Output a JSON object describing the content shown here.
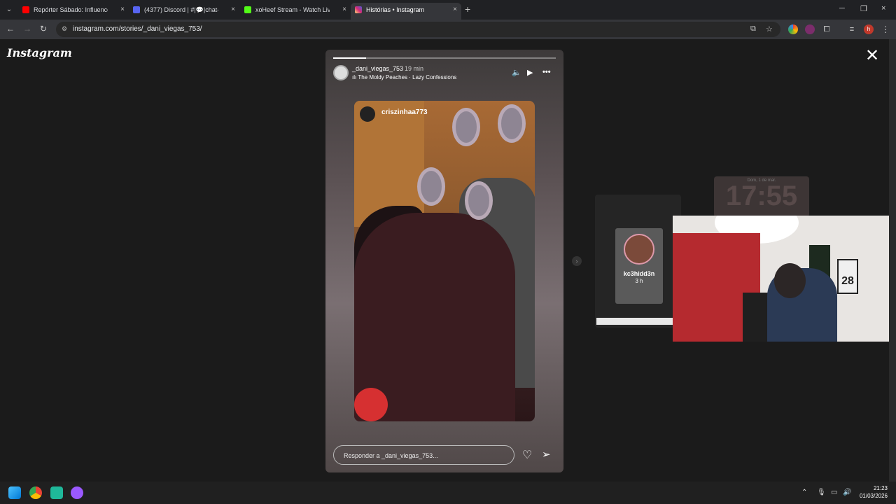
{
  "browser": {
    "tabs": [
      {
        "title": "Repórter Sábado: Influencers p",
        "favicon_color": "#ff0000",
        "active": false
      },
      {
        "title": "(4377) Discord | #|💬|chat-gen",
        "favicon_color": "#5865f2",
        "active": false
      },
      {
        "title": "xoHeef Stream - Watch Live on",
        "favicon_color": "#53fc18",
        "active": false
      },
      {
        "title": "Histórias • Instagram",
        "favicon_color": "#e1306c",
        "active": true
      }
    ],
    "url": "instagram.com/stories/_dani_viegas_753/",
    "new_tab_label": "+",
    "close_glyph": "×",
    "min_glyph": "─",
    "max_glyph": "❐"
  },
  "instagram": {
    "logo": "Instagram",
    "close": "✕",
    "story": {
      "username": "_dani_viegas_753",
      "time": "19 min",
      "music": "The Moldy Peaches · Lazy Confessions",
      "progress": [
        1.0,
        0.0,
        0.0,
        0.0,
        0.0,
        0.0
      ],
      "embedded_username": "criszinhaa773",
      "reply_placeholder": "Responder a _dani_viegas_753..."
    },
    "side_story": {
      "name": "kc3hidd3n",
      "time": "3 h"
    },
    "far_story": {
      "date": "Dom, 1 de mar.",
      "clock": "17:55"
    },
    "webcam_jersey": "28"
  },
  "taskbar": {
    "time": "21:23",
    "date": "01/03/2026",
    "badge": "h"
  }
}
